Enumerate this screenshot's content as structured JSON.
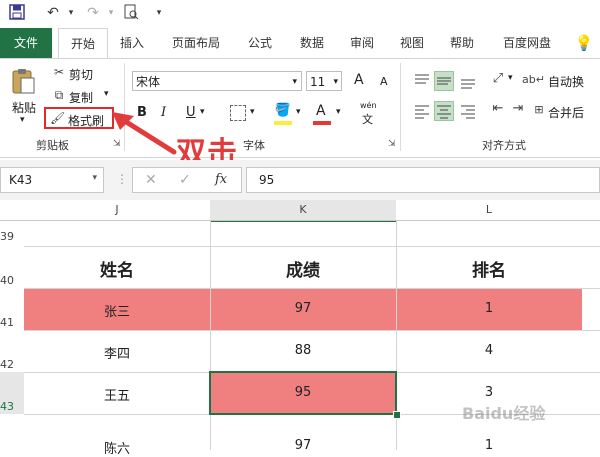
{
  "qat": {
    "icons": [
      "save-icon",
      "undo-icon",
      "redo-icon",
      "print-preview-icon"
    ]
  },
  "tabs": [
    "文件",
    "开始",
    "插入",
    "页面布局",
    "公式",
    "数据",
    "审阅",
    "视图",
    "帮助",
    "百度网盘"
  ],
  "clipboard": {
    "paste": "粘贴",
    "cut": "剪切",
    "copy": "复制",
    "format_painter": "格式刷",
    "label": "剪贴板"
  },
  "font": {
    "name": "宋体",
    "size": "11",
    "bold": "B",
    "italic": "I",
    "underline": "U",
    "grow": "A",
    "shrink": "A",
    "phonetic_top": "wén",
    "phonetic_bottom": "文",
    "label": "字体"
  },
  "alignment": {
    "wrap": "自动换",
    "merge": "合并后",
    "label": "对齐方式"
  },
  "annotation": {
    "text": "双击",
    "color": "#e23b3b"
  },
  "formula_bar": {
    "name_box": "K43",
    "fx": "fx",
    "value": "95"
  },
  "grid": {
    "columns": [
      "J",
      "K",
      "L"
    ],
    "rows": [
      {
        "num": "39",
        "cells": [
          "",
          "",
          ""
        ]
      },
      {
        "num": "40",
        "cells": [
          "姓名",
          "成绩",
          "排名"
        ]
      },
      {
        "num": "41",
        "cells": [
          "张三",
          "97",
          "1"
        ]
      },
      {
        "num": "42",
        "cells": [
          "李四",
          "88",
          "4"
        ]
      },
      {
        "num": "43",
        "cells": [
          "王五",
          "95",
          "3"
        ]
      },
      {
        "num": "",
        "cells": [
          "陈六",
          "97",
          "1"
        ]
      }
    ],
    "highlight_color": "#f08080",
    "selected_cell": "K43"
  },
  "watermark": "Baidu经验",
  "accent": "#217346"
}
